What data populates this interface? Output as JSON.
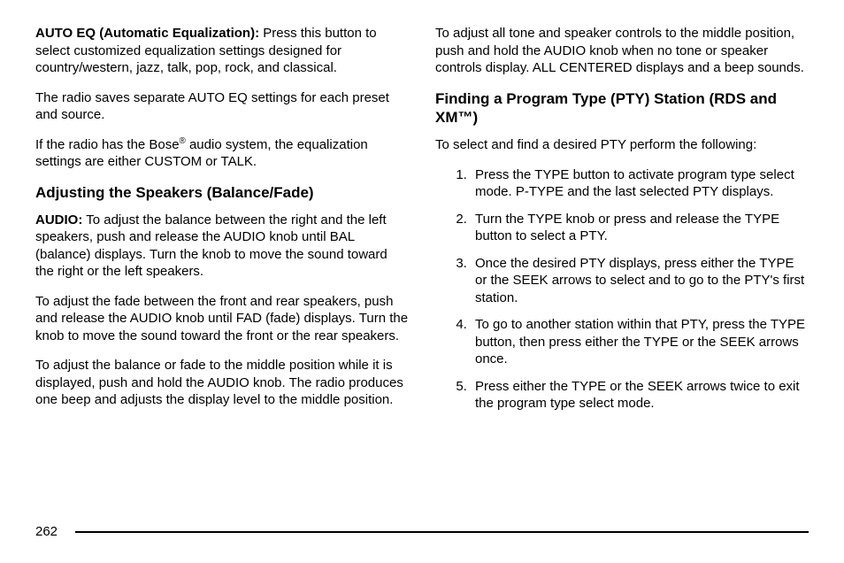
{
  "left": {
    "p1_label": "AUTO EQ (Automatic Equalization):",
    "p1_text": "  Press this button to select customized equalization settings designed for country/western, jazz, talk, pop, rock, and classical.",
    "p2": "The radio saves separate AUTO EQ settings for each preset and source.",
    "p3_a": "If the radio has the Bose",
    "p3_sup": "®",
    "p3_b": " audio system, the equalization settings are either CUSTOM or TALK.",
    "h1": "Adjusting the Speakers (Balance/Fade)",
    "p4_label": "AUDIO:",
    "p4_text": "  To adjust the balance between the right and the left speakers, push and release the AUDIO knob until BAL (balance) displays. Turn the knob to move the sound toward the right or the left speakers.",
    "p5": "To adjust the fade between the front and rear speakers, push and release the AUDIO knob until FAD (fade) displays. Turn the knob to move the sound toward the front or the rear speakers.",
    "p6": "To adjust the balance or fade to the middle position while it is displayed, push and hold the AUDIO knob. The radio produces one beep and adjusts the display level to the middle position."
  },
  "right": {
    "p1": "To adjust all tone and speaker controls to the middle position, push and hold the AUDIO knob when no tone or speaker controls display. ALL CENTERED displays and a beep sounds.",
    "h1": "Finding a Program Type (PTY) Station (RDS and XM™)",
    "p2": "To select and find a desired PTY perform the following:",
    "li1": "Press the TYPE button to activate program type select mode. P-TYPE and the last selected PTY displays.",
    "li2": "Turn the TYPE knob or press and release the TYPE button to select a PTY.",
    "li3": "Once the desired PTY displays, press either the TYPE or the SEEK arrows to select and to go to the PTY's first station.",
    "li4": "To go to another station within that PTY, press the TYPE button, then press either the TYPE or the SEEK arrows once.",
    "li5": "Press either the TYPE or the SEEK arrows twice to exit the program type select mode."
  },
  "pagenum": "262"
}
